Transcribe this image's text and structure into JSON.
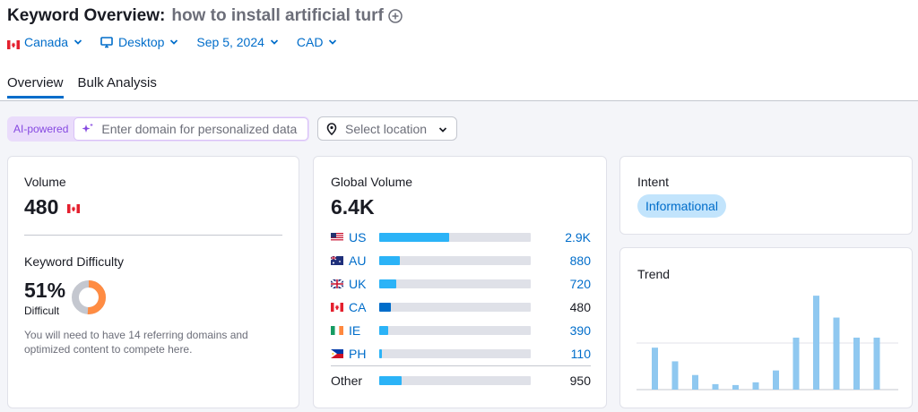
{
  "header": {
    "title": "Keyword Overview:",
    "keyword": "how to install artificial turf",
    "filters": {
      "country": "Canada",
      "device": "Desktop",
      "date": "Sep 5, 2024",
      "currency": "CAD"
    },
    "tabs": [
      {
        "label": "Overview",
        "active": true
      },
      {
        "label": "Bulk Analysis",
        "active": false
      }
    ]
  },
  "toolbar": {
    "ai_label": "AI-powered",
    "domain_placeholder": "Enter domain for personalized data",
    "location_placeholder": "Select location"
  },
  "volume": {
    "label": "Volume",
    "value": "480"
  },
  "keyword_difficulty": {
    "label": "Keyword Difficulty",
    "value": "51%",
    "percent": 51,
    "level": "Difficult",
    "description": "You will need to have 14 referring domains and optimized content to compete here.",
    "color": "#ff8c43"
  },
  "global_volume": {
    "label": "Global Volume",
    "value": "6.4K",
    "countries": [
      {
        "code": "US",
        "value": "2.9K",
        "share": 0.46
      },
      {
        "code": "AU",
        "value": "880",
        "share": 0.135
      },
      {
        "code": "UK",
        "value": "720",
        "share": 0.11
      },
      {
        "code": "CA",
        "value": "480",
        "share": 0.075
      },
      {
        "code": "IE",
        "value": "390",
        "share": 0.06
      },
      {
        "code": "PH",
        "value": "110",
        "share": 0.018
      }
    ],
    "other": {
      "label": "Other",
      "value": "950",
      "share": 0.145
    }
  },
  "intent": {
    "label": "Intent",
    "badge": "Informational"
  },
  "trend": {
    "label": "Trend"
  },
  "chart_data": {
    "type": "bar",
    "title": "Trend",
    "categories": [
      "1",
      "2",
      "3",
      "4",
      "5",
      "6",
      "7",
      "8",
      "9",
      "10",
      "11",
      "12"
    ],
    "values": [
      46,
      31,
      16,
      6,
      5,
      8,
      21,
      57,
      103,
      79,
      57,
      57
    ],
    "ylim": [
      0,
      110
    ],
    "color": "#8fc8f0"
  }
}
